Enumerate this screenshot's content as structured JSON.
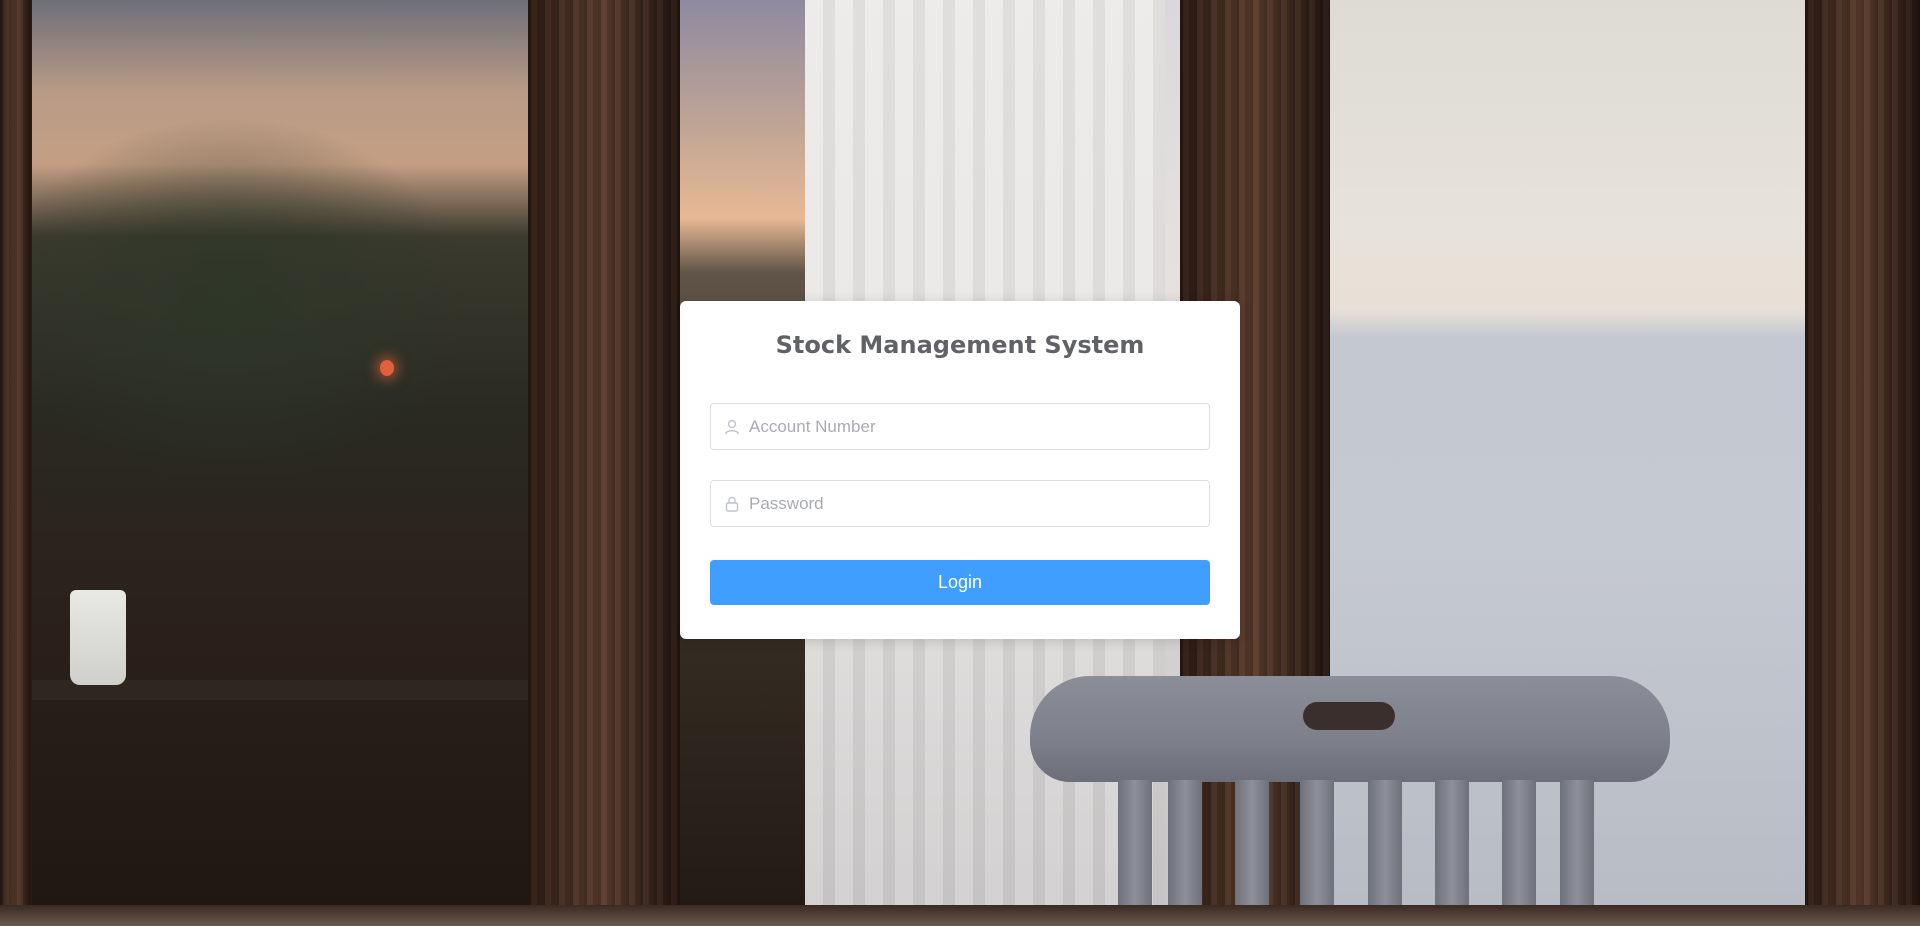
{
  "login": {
    "title": "Stock Management System",
    "account_field": {
      "value": "",
      "placeholder": "Account Number",
      "icon": "user-icon"
    },
    "password_field": {
      "value": "",
      "placeholder": "Password",
      "icon": "lock-icon"
    },
    "login_button_label": "Login"
  },
  "colors": {
    "primary": "#409eff",
    "card_background": "#ffffff",
    "title_text": "#606266",
    "input_border": "#dcdfe6",
    "placeholder": "#a8abb2"
  }
}
